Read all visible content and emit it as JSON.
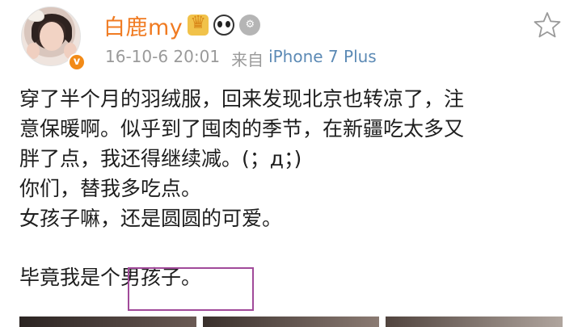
{
  "post": {
    "username": "白鹿my",
    "timestamp": "16-10-6 20:01",
    "via": "来自",
    "source": "iPhone 7 Plus",
    "verified_badge": "v",
    "badges": [
      "crown-icon",
      "panda-icon",
      "medal-icon"
    ],
    "lines": [
      "穿了半个月的羽绒服，回来发现北京也转凉了，注",
      "意保暖啊。似乎到了囤肉的季节，在新疆吃太多又",
      "胖了点，我还得继续减。(；д；)",
      "你们，替我多吃点。",
      "女孩子嘛，还是圆圆的可爱。",
      "毕竟我是个男孩子。"
    ]
  },
  "colors": {
    "username": "#f07b22",
    "source": "#5c8ab5",
    "meta": "#9a9a9a",
    "highlight_box": "#a14a9a",
    "verified": "#f28a17"
  }
}
